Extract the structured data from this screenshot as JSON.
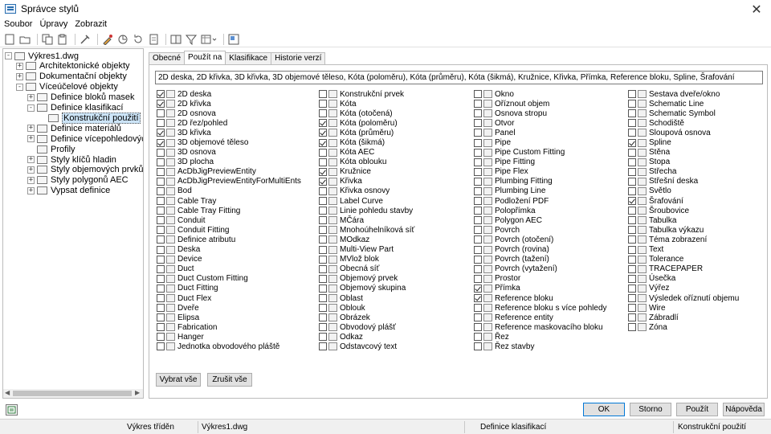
{
  "window": {
    "title": "Správce stylů"
  },
  "menu": [
    "Soubor",
    "Úpravy",
    "Zobrazit"
  ],
  "tree": [
    {
      "label": "Výkres1.dwg",
      "level": 0,
      "exp": "-"
    },
    {
      "label": "Architektonické objekty",
      "level": 1,
      "exp": "+"
    },
    {
      "label": "Dokumentační objekty",
      "level": 1,
      "exp": "+"
    },
    {
      "label": "Víceúčelové objekty",
      "level": 1,
      "exp": "-"
    },
    {
      "label": "Definice bloků masek",
      "level": 2,
      "exp": "+"
    },
    {
      "label": "Definice klasifikací",
      "level": 2,
      "exp": "-"
    },
    {
      "label": "Konstrukční použití",
      "level": 3,
      "exp": "",
      "selected": true
    },
    {
      "label": "Definice materiálů",
      "level": 2,
      "exp": "+"
    },
    {
      "label": "Definice vícepohledových blok",
      "level": 2,
      "exp": "+"
    },
    {
      "label": "Profily",
      "level": 2,
      "exp": ""
    },
    {
      "label": "Styly klíčů hladin",
      "level": 2,
      "exp": "+"
    },
    {
      "label": "Styly objemových prvků",
      "level": 2,
      "exp": "+"
    },
    {
      "label": "Styly polygonů AEC",
      "level": 2,
      "exp": "+"
    },
    {
      "label": "Vypsat definice",
      "level": 2,
      "exp": "+"
    }
  ],
  "tabs": [
    "Obecné",
    "Použít na",
    "Klasifikace",
    "Historie verzí"
  ],
  "applies_to_text": "2D deska, 2D křivka, 3D křivka, 3D objemové těleso, Kóta (poloměru), Kóta (průměru), Kóta (šikmá), Kružnice, Křivka, Přímka, Reference bloku, Spline, Šrafování",
  "columns": [
    [
      {
        "label": "2D deska",
        "checked": true
      },
      {
        "label": "2D křivka",
        "checked": true
      },
      {
        "label": "2D osnova",
        "checked": false
      },
      {
        "label": "2D řez/pohled",
        "checked": false
      },
      {
        "label": "3D křivka",
        "checked": true
      },
      {
        "label": "3D objemové těleso",
        "checked": true
      },
      {
        "label": "3D osnova",
        "checked": false
      },
      {
        "label": "3D plocha",
        "checked": false
      },
      {
        "label": "AcDbJigPreviewEntity",
        "checked": false
      },
      {
        "label": "AcDbJigPreviewEntityForMultiEnts",
        "checked": false
      },
      {
        "label": "Bod",
        "checked": false
      },
      {
        "label": "Cable Tray",
        "checked": false
      },
      {
        "label": "Cable Tray Fitting",
        "checked": false
      },
      {
        "label": "Conduit",
        "checked": false
      },
      {
        "label": "Conduit Fitting",
        "checked": false
      },
      {
        "label": "Definice atributu",
        "checked": false
      },
      {
        "label": "Deska",
        "checked": false
      },
      {
        "label": "Device",
        "checked": false
      },
      {
        "label": "Duct",
        "checked": false
      },
      {
        "label": "Duct Custom Fitting",
        "checked": false
      },
      {
        "label": "Duct Fitting",
        "checked": false
      },
      {
        "label": "Duct Flex",
        "checked": false
      },
      {
        "label": "Dveře",
        "checked": false
      },
      {
        "label": "Elipsa",
        "checked": false
      },
      {
        "label": "Fabrication",
        "checked": false
      },
      {
        "label": "Hanger",
        "checked": false
      },
      {
        "label": "Jednotka obvodového pláště",
        "checked": false
      }
    ],
    [
      {
        "label": "Konstrukční prvek",
        "checked": false
      },
      {
        "label": "Kóta",
        "checked": false
      },
      {
        "label": "Kóta (otočená)",
        "checked": false
      },
      {
        "label": "Kóta (poloměru)",
        "checked": true
      },
      {
        "label": "Kóta (průměru)",
        "checked": true
      },
      {
        "label": "Kóta (šikmá)",
        "checked": true
      },
      {
        "label": "Kóta AEC",
        "checked": false
      },
      {
        "label": "Kóta oblouku",
        "checked": false
      },
      {
        "label": "Kružnice",
        "checked": true
      },
      {
        "label": "Křivka",
        "checked": true
      },
      {
        "label": "Křivka osnovy",
        "checked": false
      },
      {
        "label": "Label Curve",
        "checked": false
      },
      {
        "label": "Linie pohledu stavby",
        "checked": false
      },
      {
        "label": "MČára",
        "checked": false
      },
      {
        "label": "Mnohoúhelníková síť",
        "checked": false
      },
      {
        "label": "MOdkaz",
        "checked": false
      },
      {
        "label": "Multi-View Part",
        "checked": false
      },
      {
        "label": "MVlož blok",
        "checked": false
      },
      {
        "label": "Obecná síť",
        "checked": false
      },
      {
        "label": "Objemový prvek",
        "checked": false
      },
      {
        "label": "Objemový skupina",
        "checked": false
      },
      {
        "label": "Oblast",
        "checked": false
      },
      {
        "label": "Oblouk",
        "checked": false
      },
      {
        "label": "Obrázek",
        "checked": false
      },
      {
        "label": "Obvodový plášť",
        "checked": false
      },
      {
        "label": "Odkaz",
        "checked": false
      },
      {
        "label": "Odstavcový text",
        "checked": false
      }
    ],
    [
      {
        "label": "Okno",
        "checked": false
      },
      {
        "label": "Oříznout objem",
        "checked": false
      },
      {
        "label": "Osnova stropu",
        "checked": false
      },
      {
        "label": "Otvor",
        "checked": false
      },
      {
        "label": "Panel",
        "checked": false
      },
      {
        "label": "Pipe",
        "checked": false
      },
      {
        "label": "Pipe Custom Fitting",
        "checked": false
      },
      {
        "label": "Pipe Fitting",
        "checked": false
      },
      {
        "label": "Pipe Flex",
        "checked": false
      },
      {
        "label": "Plumbing Fitting",
        "checked": false
      },
      {
        "label": "Plumbing Line",
        "checked": false
      },
      {
        "label": "Podložení PDF",
        "checked": false
      },
      {
        "label": "Polopřímka",
        "checked": false
      },
      {
        "label": "Polygon AEC",
        "checked": false
      },
      {
        "label": "Povrch",
        "checked": false
      },
      {
        "label": "Povrch (otočení)",
        "checked": false
      },
      {
        "label": "Povrch (rovina)",
        "checked": false
      },
      {
        "label": "Povrch (tažení)",
        "checked": false
      },
      {
        "label": "Povrch (vytažení)",
        "checked": false
      },
      {
        "label": "Prostor",
        "checked": false
      },
      {
        "label": "Přímka",
        "checked": true
      },
      {
        "label": "Reference bloku",
        "checked": true
      },
      {
        "label": "Reference bloku s více pohledy",
        "checked": false
      },
      {
        "label": "Reference entity",
        "checked": false
      },
      {
        "label": "Reference maskovacího bloku",
        "checked": false
      },
      {
        "label": "Řez",
        "checked": false
      },
      {
        "label": "Řez stavby",
        "checked": false
      }
    ],
    [
      {
        "label": "Sestava dveře/okno",
        "checked": false
      },
      {
        "label": "Schematic Line",
        "checked": false
      },
      {
        "label": "Schematic Symbol",
        "checked": false
      },
      {
        "label": "Schodiště",
        "checked": false
      },
      {
        "label": "Sloupová osnova",
        "checked": false
      },
      {
        "label": "Spline",
        "checked": true
      },
      {
        "label": "Stěna",
        "checked": false
      },
      {
        "label": "Stopa",
        "checked": false
      },
      {
        "label": "Střecha",
        "checked": false
      },
      {
        "label": "Střešní deska",
        "checked": false
      },
      {
        "label": "Světlo",
        "checked": false
      },
      {
        "label": "Šrafování",
        "checked": true
      },
      {
        "label": "Šroubovice",
        "checked": false
      },
      {
        "label": "Tabulka",
        "checked": false
      },
      {
        "label": "Tabulka výkazu",
        "checked": false
      },
      {
        "label": "Téma zobrazení",
        "checked": false
      },
      {
        "label": "Text",
        "checked": false
      },
      {
        "label": "Tolerance",
        "checked": false
      },
      {
        "label": "TRACEPAPER",
        "checked": false
      },
      {
        "label": "Úsečka",
        "checked": false
      },
      {
        "label": "Výřez",
        "checked": false
      },
      {
        "label": "Výsledek oříznutí objemu",
        "checked": false
      },
      {
        "label": "Wire",
        "checked": false
      },
      {
        "label": "Zábradlí",
        "checked": false
      },
      {
        "label": "Zóna",
        "checked": false
      }
    ]
  ],
  "buttons": {
    "select_all": "Vybrat vše",
    "clear_all": "Zrušit vše",
    "ok": "OK",
    "cancel": "Storno",
    "apply": "Použít",
    "help": "Nápověda"
  },
  "status": {
    "sort": "Výkres tříděn",
    "drawing": "Výkres1.dwg",
    "section": "Definice klasifikací",
    "item": "Konstrukční použití"
  }
}
